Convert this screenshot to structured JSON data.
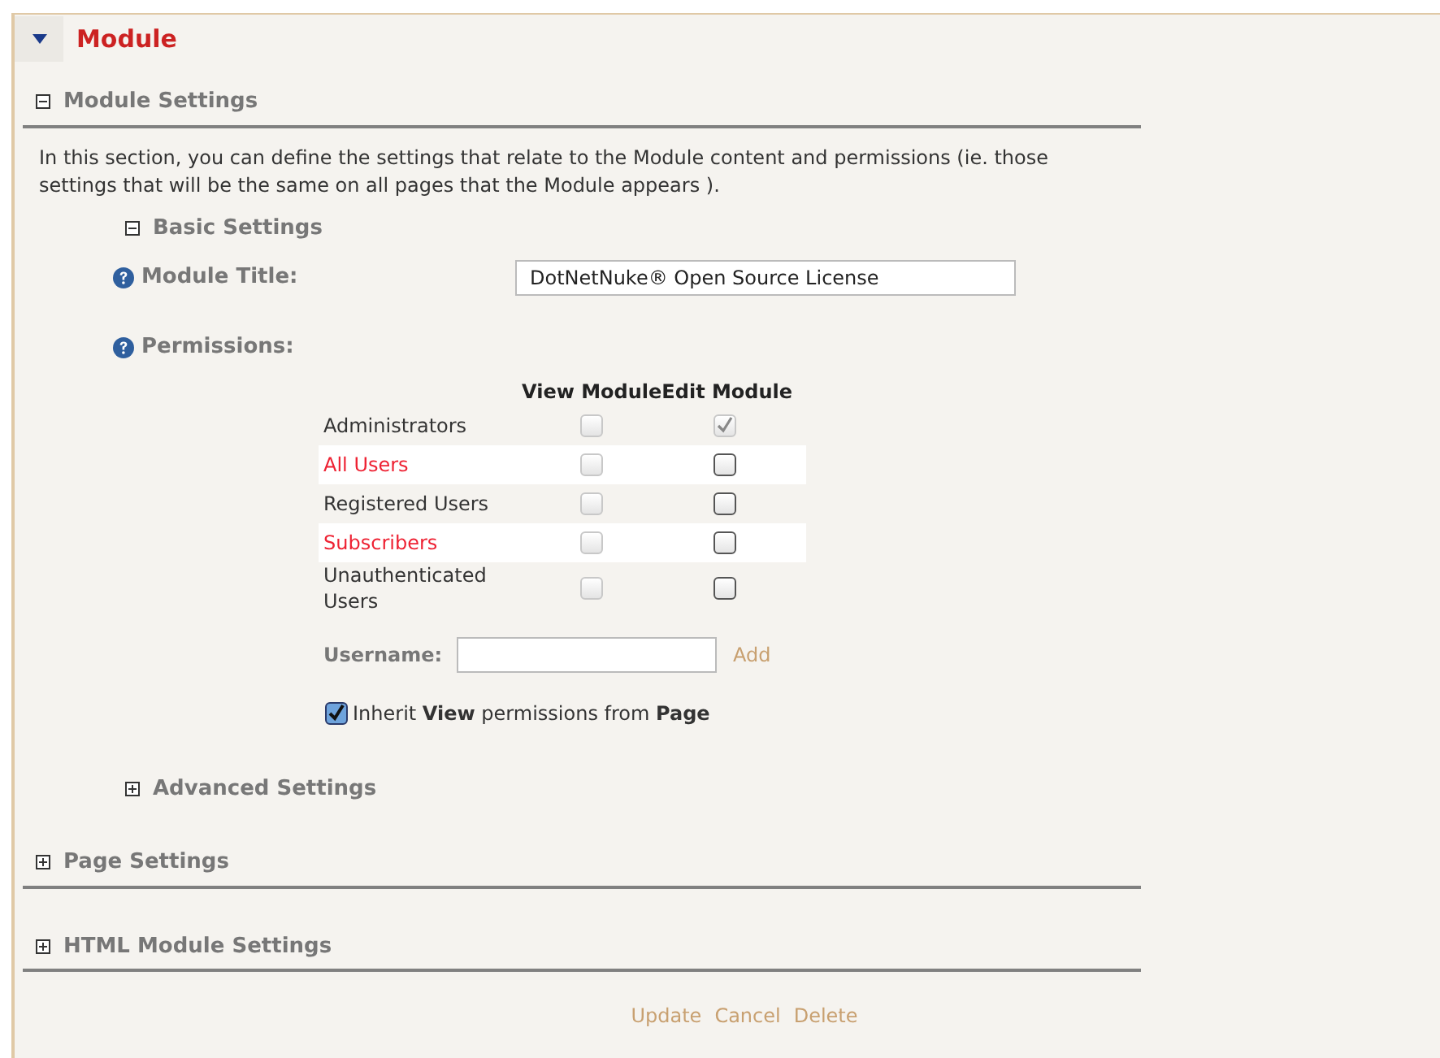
{
  "header": {
    "title": "Module",
    "expanded": true
  },
  "module_settings": {
    "title": "Module Settings",
    "expanded": true,
    "description": "In this section, you can define the settings that relate to the Module content and permissions (ie. those settings that will be the same on all pages that the Module appears ).",
    "basic_settings": {
      "title": "Basic Settings",
      "expanded": true,
      "module_title": {
        "label": "Module Title:",
        "value": "DotNetNuke® Open Source License"
      },
      "permissions": {
        "label": "Permissions:",
        "columns": [
          "View Module",
          "Edit Module"
        ],
        "rows": [
          {
            "name": "Administrators",
            "highlighted": false,
            "cells": [
              {
                "checked": false,
                "disabled": true
              },
              {
                "checked": true,
                "disabled": true
              }
            ]
          },
          {
            "name": "All Users",
            "highlighted": true,
            "cells": [
              {
                "checked": false,
                "disabled": true
              },
              {
                "checked": false,
                "disabled": false
              }
            ]
          },
          {
            "name": "Registered Users",
            "highlighted": false,
            "cells": [
              {
                "checked": false,
                "disabled": true
              },
              {
                "checked": false,
                "disabled": false
              }
            ]
          },
          {
            "name": "Subscribers",
            "highlighted": true,
            "cells": [
              {
                "checked": false,
                "disabled": true
              },
              {
                "checked": false,
                "disabled": false
              }
            ]
          },
          {
            "name": "Unauthenticated Users",
            "highlighted": false,
            "cells": [
              {
                "checked": false,
                "disabled": true
              },
              {
                "checked": false,
                "disabled": false
              }
            ]
          }
        ],
        "username_label": "Username:",
        "add_link": "Add",
        "inherit": {
          "text": "Inherit **View** permissions from **Page**",
          "checked": true
        }
      }
    },
    "advanced_settings": {
      "title": "Advanced Settings",
      "expanded": false
    }
  },
  "sections": [
    {
      "title": "Page Settings",
      "expanded": false
    },
    {
      "title": "HTML Module Settings",
      "expanded": false
    }
  ],
  "actions": [
    "Update",
    "Cancel",
    "Delete"
  ]
}
